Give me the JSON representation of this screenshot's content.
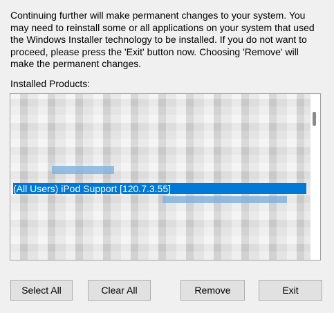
{
  "intro_text": "Continuing further will make permanent changes to your system. You may need to reinstall some or all applications on your system that used the Windows Installer technology to be installed. If you do not want to proceed, please press the 'Exit' button now. Choosing 'Remove' will make the permanent changes.",
  "products_label": "Installed Products:",
  "list": {
    "selected_item": "(All Users) iPod Support [120.7.3.55]"
  },
  "buttons": {
    "select_all": "Select All",
    "clear_all": "Clear All",
    "remove": "Remove",
    "exit": "Exit"
  },
  "colors": {
    "selection": "#0078d7",
    "window_bg": "#f0f0f0"
  }
}
